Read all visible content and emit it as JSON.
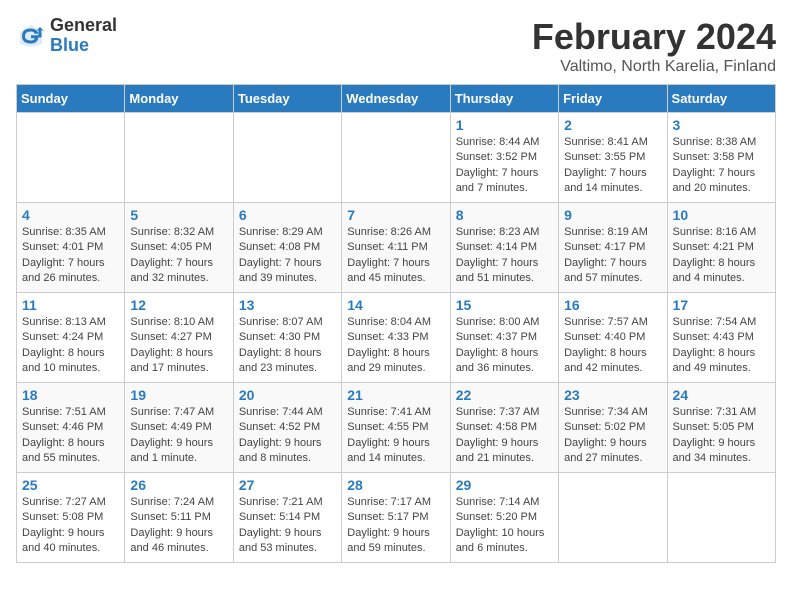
{
  "header": {
    "logo_general": "General",
    "logo_blue": "Blue",
    "title": "February 2024",
    "subtitle": "Valtimo, North Karelia, Finland"
  },
  "days_of_week": [
    "Sunday",
    "Monday",
    "Tuesday",
    "Wednesday",
    "Thursday",
    "Friday",
    "Saturday"
  ],
  "weeks": [
    [
      {
        "day": "",
        "info": ""
      },
      {
        "day": "",
        "info": ""
      },
      {
        "day": "",
        "info": ""
      },
      {
        "day": "",
        "info": ""
      },
      {
        "day": "1",
        "info": "Sunrise: 8:44 AM\nSunset: 3:52 PM\nDaylight: 7 hours\nand 7 minutes."
      },
      {
        "day": "2",
        "info": "Sunrise: 8:41 AM\nSunset: 3:55 PM\nDaylight: 7 hours\nand 14 minutes."
      },
      {
        "day": "3",
        "info": "Sunrise: 8:38 AM\nSunset: 3:58 PM\nDaylight: 7 hours\nand 20 minutes."
      }
    ],
    [
      {
        "day": "4",
        "info": "Sunrise: 8:35 AM\nSunset: 4:01 PM\nDaylight: 7 hours\nand 26 minutes."
      },
      {
        "day": "5",
        "info": "Sunrise: 8:32 AM\nSunset: 4:05 PM\nDaylight: 7 hours\nand 32 minutes."
      },
      {
        "day": "6",
        "info": "Sunrise: 8:29 AM\nSunset: 4:08 PM\nDaylight: 7 hours\nand 39 minutes."
      },
      {
        "day": "7",
        "info": "Sunrise: 8:26 AM\nSunset: 4:11 PM\nDaylight: 7 hours\nand 45 minutes."
      },
      {
        "day": "8",
        "info": "Sunrise: 8:23 AM\nSunset: 4:14 PM\nDaylight: 7 hours\nand 51 minutes."
      },
      {
        "day": "9",
        "info": "Sunrise: 8:19 AM\nSunset: 4:17 PM\nDaylight: 7 hours\nand 57 minutes."
      },
      {
        "day": "10",
        "info": "Sunrise: 8:16 AM\nSunset: 4:21 PM\nDaylight: 8 hours\nand 4 minutes."
      }
    ],
    [
      {
        "day": "11",
        "info": "Sunrise: 8:13 AM\nSunset: 4:24 PM\nDaylight: 8 hours\nand 10 minutes."
      },
      {
        "day": "12",
        "info": "Sunrise: 8:10 AM\nSunset: 4:27 PM\nDaylight: 8 hours\nand 17 minutes."
      },
      {
        "day": "13",
        "info": "Sunrise: 8:07 AM\nSunset: 4:30 PM\nDaylight: 8 hours\nand 23 minutes."
      },
      {
        "day": "14",
        "info": "Sunrise: 8:04 AM\nSunset: 4:33 PM\nDaylight: 8 hours\nand 29 minutes."
      },
      {
        "day": "15",
        "info": "Sunrise: 8:00 AM\nSunset: 4:37 PM\nDaylight: 8 hours\nand 36 minutes."
      },
      {
        "day": "16",
        "info": "Sunrise: 7:57 AM\nSunset: 4:40 PM\nDaylight: 8 hours\nand 42 minutes."
      },
      {
        "day": "17",
        "info": "Sunrise: 7:54 AM\nSunset: 4:43 PM\nDaylight: 8 hours\nand 49 minutes."
      }
    ],
    [
      {
        "day": "18",
        "info": "Sunrise: 7:51 AM\nSunset: 4:46 PM\nDaylight: 8 hours\nand 55 minutes."
      },
      {
        "day": "19",
        "info": "Sunrise: 7:47 AM\nSunset: 4:49 PM\nDaylight: 9 hours\nand 1 minute."
      },
      {
        "day": "20",
        "info": "Sunrise: 7:44 AM\nSunset: 4:52 PM\nDaylight: 9 hours\nand 8 minutes."
      },
      {
        "day": "21",
        "info": "Sunrise: 7:41 AM\nSunset: 4:55 PM\nDaylight: 9 hours\nand 14 minutes."
      },
      {
        "day": "22",
        "info": "Sunrise: 7:37 AM\nSunset: 4:58 PM\nDaylight: 9 hours\nand 21 minutes."
      },
      {
        "day": "23",
        "info": "Sunrise: 7:34 AM\nSunset: 5:02 PM\nDaylight: 9 hours\nand 27 minutes."
      },
      {
        "day": "24",
        "info": "Sunrise: 7:31 AM\nSunset: 5:05 PM\nDaylight: 9 hours\nand 34 minutes."
      }
    ],
    [
      {
        "day": "25",
        "info": "Sunrise: 7:27 AM\nSunset: 5:08 PM\nDaylight: 9 hours\nand 40 minutes."
      },
      {
        "day": "26",
        "info": "Sunrise: 7:24 AM\nSunset: 5:11 PM\nDaylight: 9 hours\nand 46 minutes."
      },
      {
        "day": "27",
        "info": "Sunrise: 7:21 AM\nSunset: 5:14 PM\nDaylight: 9 hours\nand 53 minutes."
      },
      {
        "day": "28",
        "info": "Sunrise: 7:17 AM\nSunset: 5:17 PM\nDaylight: 9 hours\nand 59 minutes."
      },
      {
        "day": "29",
        "info": "Sunrise: 7:14 AM\nSunset: 5:20 PM\nDaylight: 10 hours\nand 6 minutes."
      },
      {
        "day": "",
        "info": ""
      },
      {
        "day": "",
        "info": ""
      }
    ]
  ]
}
